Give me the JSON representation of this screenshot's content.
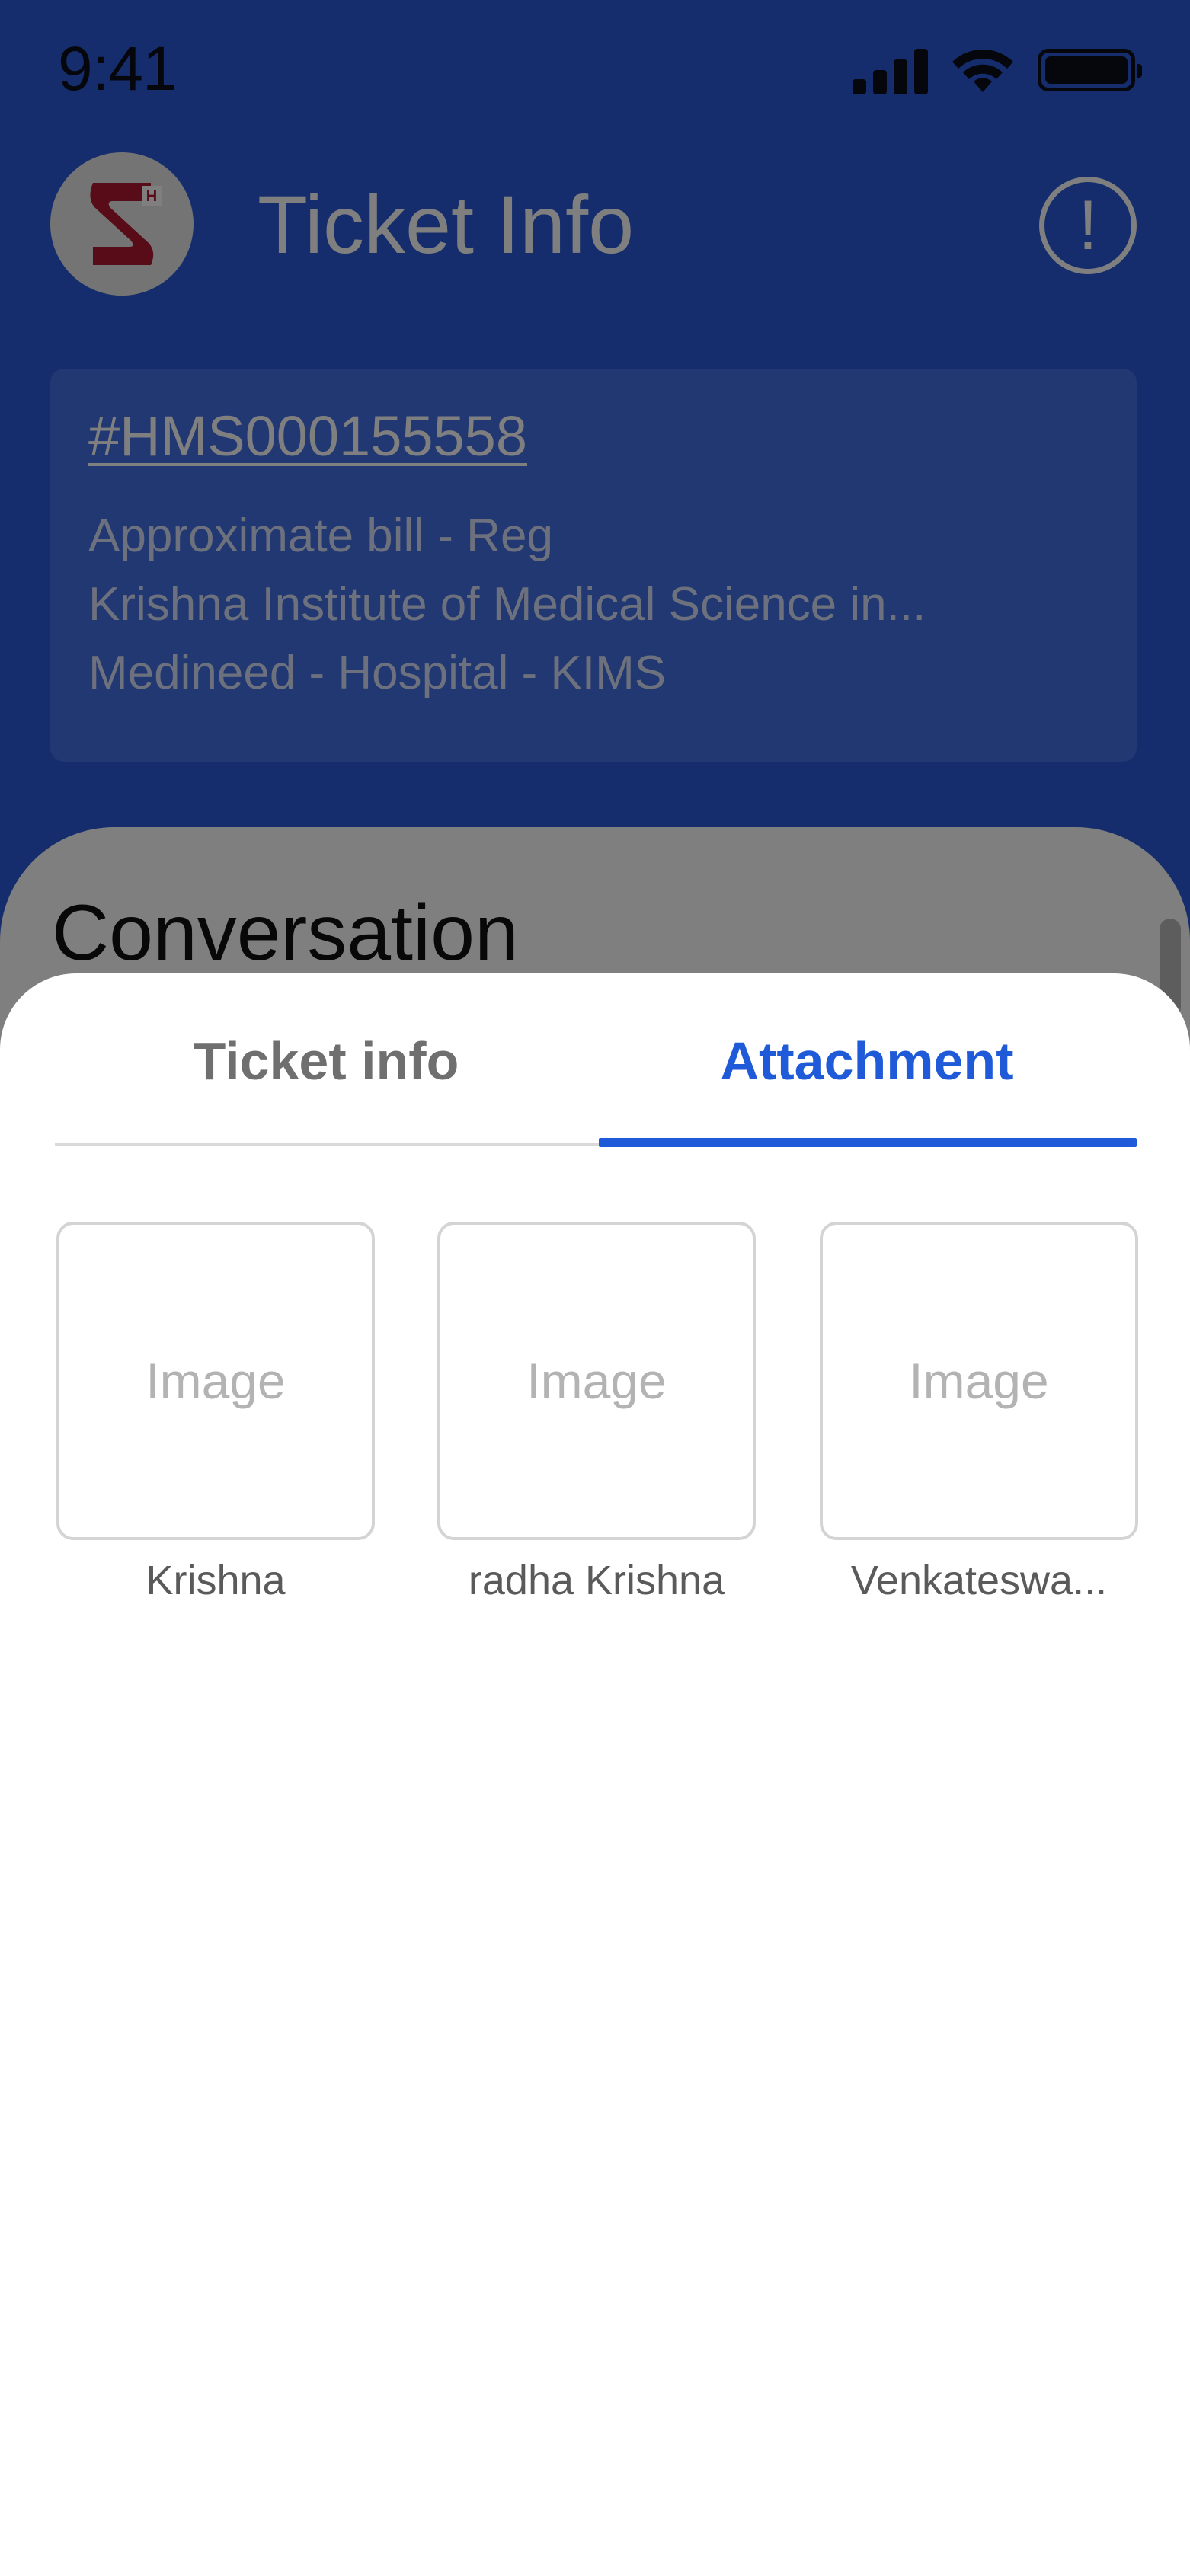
{
  "status_bar": {
    "time": "9:41",
    "icons": [
      "signal-icon",
      "wifi-icon",
      "battery-icon"
    ]
  },
  "header": {
    "title": "Ticket Info",
    "info_icon": "!"
  },
  "ticket": {
    "id": "#HMS000155558",
    "subject": "Approximate bill - Reg",
    "organization": "Krishna  Institute of Medical Science  in...",
    "department": "Medineed - Hospital - KIMS"
  },
  "conversation": {
    "title": "Conversation"
  },
  "sheet": {
    "tabs": [
      {
        "label": "Ticket info",
        "active": false
      },
      {
        "label": "Attachment",
        "active": true
      }
    ],
    "attachments": [
      {
        "thumb_label": "Image",
        "name": "Krishna"
      },
      {
        "thumb_label": "Image",
        "name": "radha Krishna"
      },
      {
        "thumb_label": "Image",
        "name": "Venkateswa..."
      }
    ]
  },
  "colors": {
    "accent": "#1f5ad8",
    "app_background": "#2a5ad8",
    "scrim": "rgba(0,0,0,0.5)",
    "logo_red": "#b0182e"
  }
}
